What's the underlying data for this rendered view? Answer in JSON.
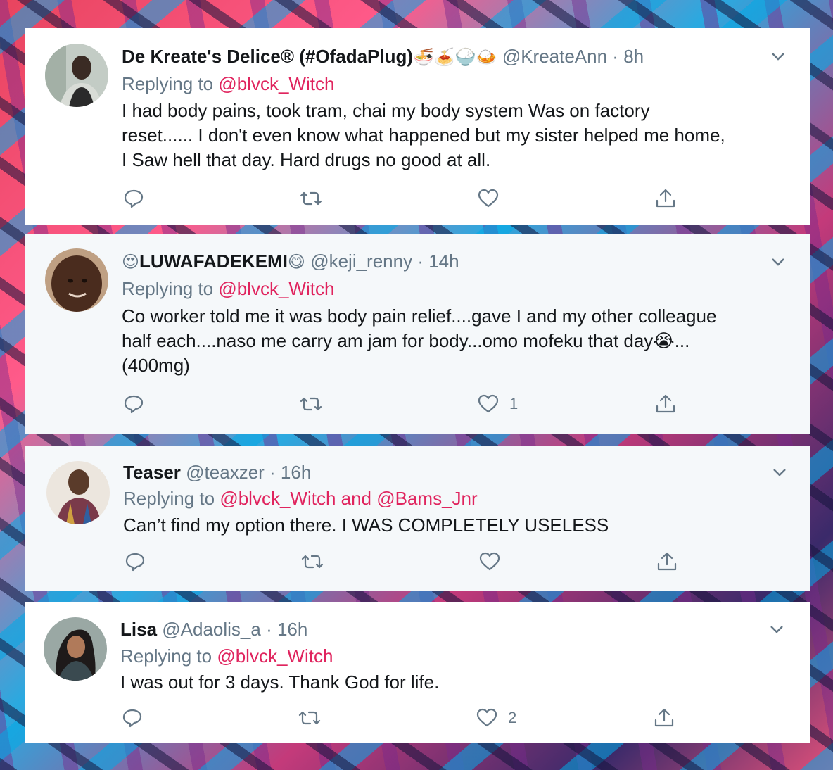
{
  "tweets": [
    {
      "name": "De Kreate's Delice® (#OfadaPlug)",
      "name_emojis": "🍜🍝🍚🍛",
      "handle": "@KreateAnn",
      "time": "8h",
      "replying_prefix": "Replying to",
      "replying_to": "@blvck_Witch",
      "text_lines": [
        "I had body pains, took tram, chai my body system Was on factory",
        "reset...... I don't even know what happened but my sister helped me home,",
        "I Saw hell that day.  Hard drugs no good at all."
      ],
      "likes": "",
      "avatar_colors": [
        "#bfc9c2",
        "#3a2b24"
      ]
    },
    {
      "name": "LUWAFADEKEMI",
      "name_prefix_emoji": "😍",
      "name_suffix_emoji": "😋",
      "handle": "@keji_renny",
      "time": "14h",
      "replying_prefix": "Replying to",
      "replying_to": "@blvck_Witch",
      "text_lines": [
        "Co worker told me it was body pain relief....gave I and my other colleague",
        "half each....naso me carry am jam for body...omo mofeku that day😭...",
        "(400mg)"
      ],
      "likes": "1",
      "avatar_colors": [
        "#caa88a",
        "#3b241a"
      ]
    },
    {
      "name": "Teaser",
      "handle": "@teaxzer",
      "time": "16h",
      "replying_prefix": "Replying to",
      "replying_to": "@blvck_Witch and @Bams_Jnr",
      "text_lines": [
        "Can’t find my option there. I WAS COMPLETELY USELESS"
      ],
      "likes": "",
      "avatar_colors": [
        "#e8e2da",
        "#5a3b2a"
      ]
    },
    {
      "name": "Lisa",
      "handle": "@Adaolis_a",
      "time": "16h",
      "replying_prefix": "Replying to",
      "replying_to": "@blvck_Witch",
      "text_lines": [
        "I was out for 3 days. Thank God for life."
      ],
      "likes": "2",
      "avatar_colors": [
        "#8a9a96",
        "#1e1a1a"
      ]
    }
  ],
  "icons": {
    "reply": "reply-icon",
    "retweet": "retweet-icon",
    "like": "like-icon",
    "share": "share-icon",
    "more": "chevron-down-icon"
  },
  "colors": {
    "mention": "#e0245e",
    "secondary_text": "#657786",
    "primary_text": "#14171a",
    "card_hover": "#f5f8fa"
  }
}
